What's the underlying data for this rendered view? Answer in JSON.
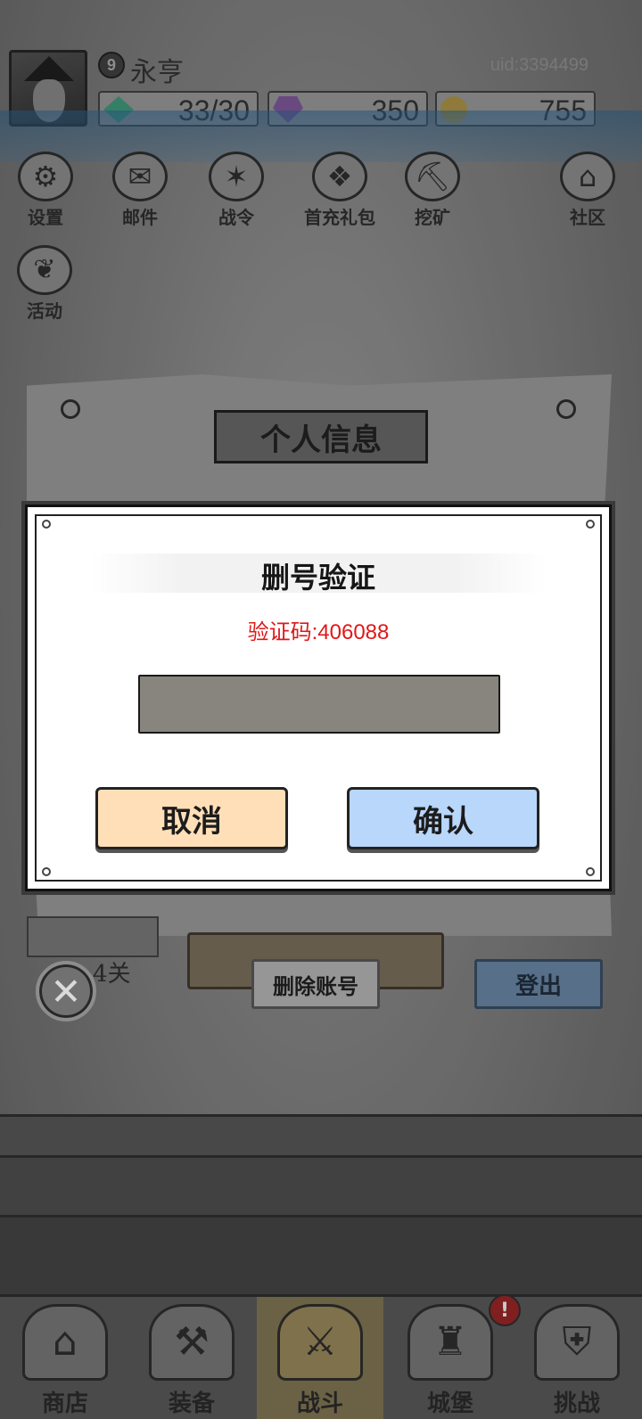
{
  "player": {
    "level": "9",
    "name": "永亨",
    "uid": "uid:3394499"
  },
  "resources": {
    "stamina": "33/30",
    "gems": "350",
    "gold": "755"
  },
  "features": [
    {
      "label": "设置",
      "icon": "gear-icon"
    },
    {
      "label": "邮件",
      "icon": "mail-icon"
    },
    {
      "label": "战令",
      "icon": "battle-pass-icon"
    },
    {
      "label": "首充礼包",
      "icon": "gift-bag-icon"
    },
    {
      "label": "挖矿",
      "icon": "mining-icon"
    },
    {
      "label": "社区",
      "icon": "home-icon"
    }
  ],
  "activity": {
    "label": "活动",
    "icon": "laurel-icon"
  },
  "board": {
    "title": "个人信息",
    "stage_suffix": "4关",
    "delete_account": "删除账号",
    "logout": "登出"
  },
  "bottom_nav": [
    {
      "label": "商店",
      "icon": "shop-icon"
    },
    {
      "label": "装备",
      "icon": "backpack-icon"
    },
    {
      "label": "战斗",
      "icon": "crossed-swords-icon"
    },
    {
      "label": "城堡",
      "icon": "castle-icon"
    },
    {
      "label": "挑战",
      "icon": "locked-shield-icon"
    }
  ],
  "alert_badge": "!",
  "modal": {
    "title": "删号验证",
    "code_text": "验证码:406088",
    "input_value": "",
    "cancel": "取消",
    "confirm": "确认"
  },
  "colors": {
    "verify_code": "#e01818",
    "cancel_button": "#ffdfb8",
    "confirm_button": "#b9d6fb",
    "input_fill": "#88857e"
  }
}
